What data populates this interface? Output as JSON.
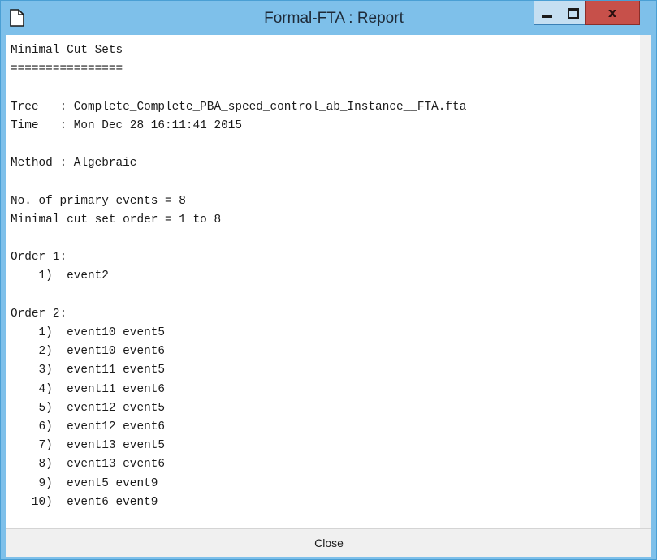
{
  "window": {
    "title": "Formal-FTA : Report",
    "icon": "document-icon",
    "minimize_icon": "minimize-icon",
    "maximize_icon": "maximize-icon",
    "close_icon": "close-icon",
    "close_glyph": "x"
  },
  "report": {
    "text": "Minimal Cut Sets\n================\n\nTree   : Complete_Complete_PBA_speed_control_ab_Instance__FTA.fta\nTime   : Mon Dec 28 16:11:41 2015\n\nMethod : Algebraic\n\nNo. of primary events = 8\nMinimal cut set order = 1 to 8\n\nOrder 1:\n    1)  event2\n\nOrder 2:\n    1)  event10 event5\n    2)  event10 event6\n    3)  event11 event5\n    4)  event11 event6\n    5)  event12 event5\n    6)  event12 event6\n    7)  event13 event5\n    8)  event13 event6\n    9)  event5 event9\n   10)  event6 event9"
  },
  "footer": {
    "close_label": "Close"
  },
  "colors": {
    "frame": "#7ec0ea",
    "close_button_bg": "#c7504a"
  }
}
